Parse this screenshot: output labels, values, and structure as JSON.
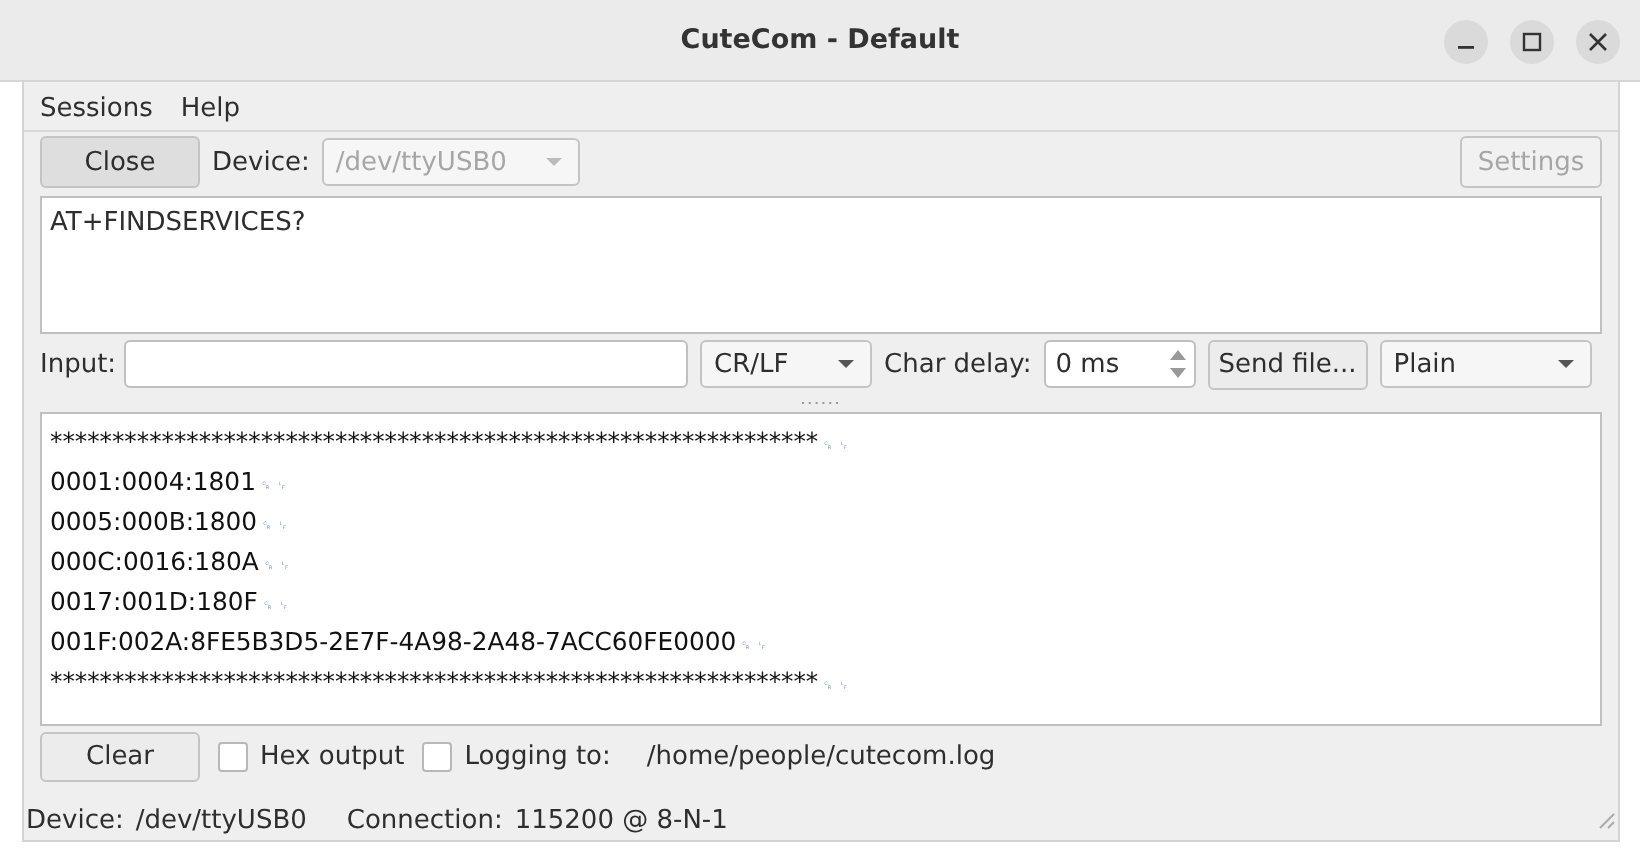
{
  "window": {
    "title": "CuteCom - Default"
  },
  "menu": [
    "Sessions",
    "Help"
  ],
  "toolbar": {
    "close_button": "Close",
    "device_label": "Device:",
    "device_value": "/dev/ttyUSB0",
    "device_disabled": true,
    "settings_button": "Settings",
    "settings_disabled": true
  },
  "sent_text": "AT+FINDSERVICES?",
  "input_row": {
    "label": "Input:",
    "line_ending": "CR/LF",
    "char_delay_label": "Char delay:",
    "char_delay_value": "0 ms",
    "send_file_button": "Send file...",
    "format": "Plain"
  },
  "output_lines": [
    {
      "text": "**************************************************************",
      "line_end": "␍␊"
    },
    {
      "text": "0001:0004:1801",
      "line_end": "␍␊"
    },
    {
      "text": "0005:000B:1800",
      "line_end": "␍␊"
    },
    {
      "text": "000C:0016:180A",
      "line_end": "␍␊"
    },
    {
      "text": "0017:001D:180F",
      "line_end": "␍␊"
    },
    {
      "text": "001F:002A:8FE5B3D5-2E7F-4A98-2A48-7ACC60FE0000",
      "line_end": "␍␊"
    },
    {
      "text": "**************************************************************",
      "line_end": "␍␊"
    }
  ],
  "bottom_row": {
    "clear_button": "Clear",
    "hex_output": {
      "label": "Hex output",
      "checked": false
    },
    "logging": {
      "label": "Logging to:",
      "checked": false
    },
    "log_path": "/home/people/cutecom.log"
  },
  "status_bar": {
    "device_label": "Device:",
    "device_value": "/dev/ttyUSB0",
    "connection_label": "Connection:",
    "connection_value": "115200 @ 8-N-1"
  }
}
